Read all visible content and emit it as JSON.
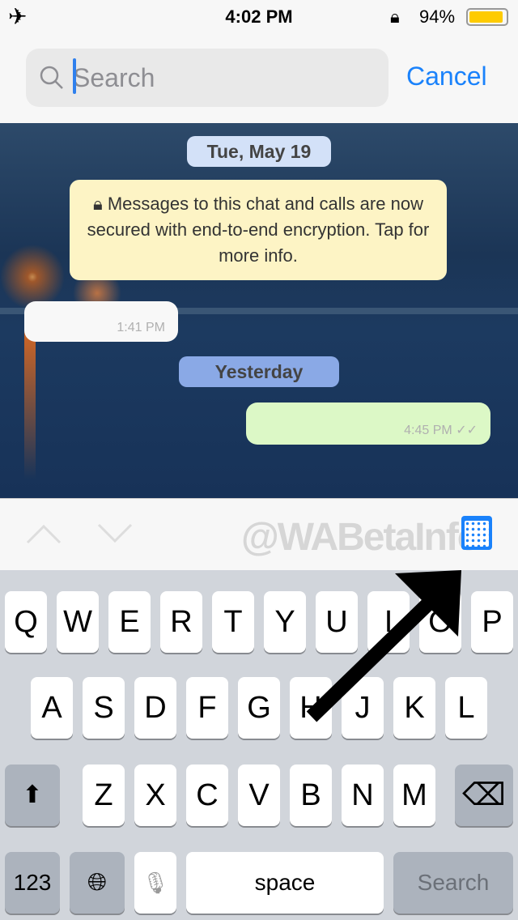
{
  "status": {
    "time": "4:02 PM",
    "battery": "94%",
    "battery_level": 94,
    "icons": [
      "airplane-icon",
      "rotation-lock-icon",
      "battery-icon"
    ]
  },
  "search": {
    "placeholder": "Search",
    "value": "",
    "cancel": "Cancel"
  },
  "chat": {
    "date_header": "Tue, May 19",
    "encryption_notice": "Messages to this chat and calls are now secured with end-to-end encryption. Tap for more info.",
    "messages": [
      {
        "direction": "incoming",
        "time": "1:41 PM"
      },
      {
        "direction": "outgoing",
        "time": "4:45 PM",
        "status": "read-ticks"
      }
    ],
    "divider": "Yesterday"
  },
  "toolbar": {
    "watermark": "@WABetaInfo",
    "icons": [
      "chevron-up-icon",
      "chevron-down-icon",
      "calendar-icon"
    ],
    "accent": "#1a82fb"
  },
  "keyboard": {
    "row1": [
      "Q",
      "W",
      "E",
      "R",
      "T",
      "Y",
      "U",
      "I",
      "O",
      "P"
    ],
    "row2": [
      "A",
      "S",
      "D",
      "F",
      "G",
      "H",
      "J",
      "K",
      "L"
    ],
    "row3": [
      "Z",
      "X",
      "C",
      "V",
      "B",
      "N",
      "M"
    ],
    "numbers": "123",
    "space": "space",
    "search": "Search"
  }
}
